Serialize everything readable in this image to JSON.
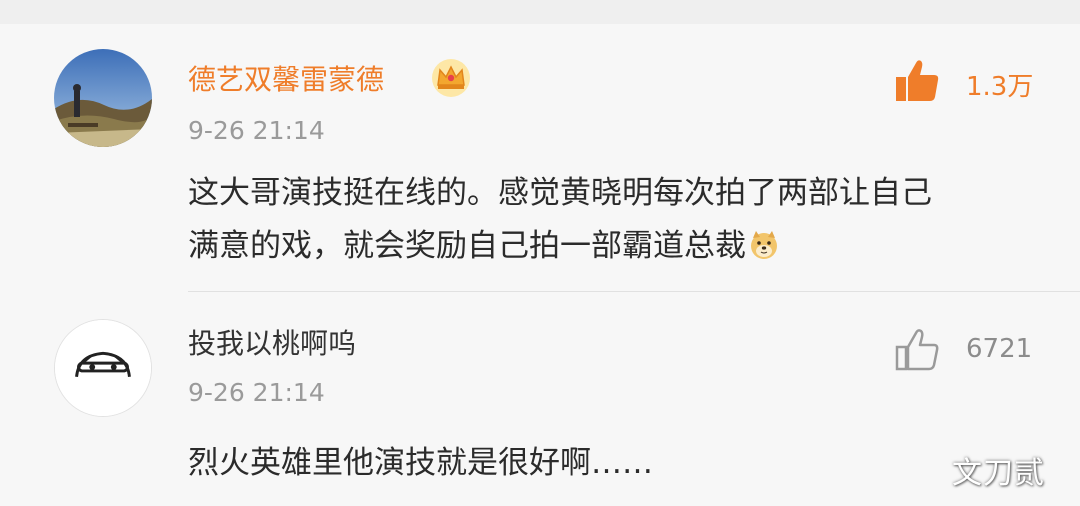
{
  "comments": [
    {
      "username": "德艺双馨雷蒙德",
      "vip_badge": "crown-icon",
      "timestamp": "9-26 21:14",
      "likes": "1.3万",
      "like_color": "#ef7d2a",
      "text_line1": "这大哥演技挺在线的。感觉黄晓明每次拍了两部让自己",
      "text_line2": "满意的戏，就会奖励自己拍一部霸道总裁",
      "emoji": "doge-emoji"
    },
    {
      "username": "投我以桃啊呜",
      "timestamp": "9-26 21:14",
      "likes": "6721",
      "like_color": "#8c8c8c",
      "text_line1": "烈火英雄里他演技就是很好啊……"
    }
  ],
  "watermark": "文刀贰"
}
